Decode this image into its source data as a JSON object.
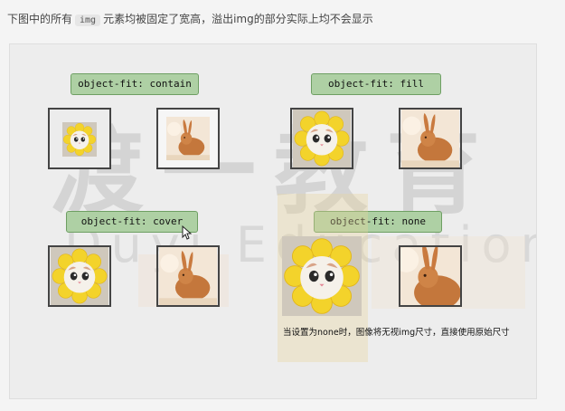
{
  "intro": {
    "prefix": "下图中的所有",
    "code": "img",
    "suffix": "元素均被固定了宽高，溢出img的部分实际上均不会显示"
  },
  "watermark": {
    "chinese": "渡一教育",
    "english": "Duyi Education"
  },
  "demos": [
    {
      "label": "object-fit: contain"
    },
    {
      "label": "object-fit: fill"
    },
    {
      "label": "object-fit: cover"
    },
    {
      "label": "object-fit:  none"
    }
  ],
  "note": "当设置为none时，图像将无视img尺寸，直接使用原始尺寸",
  "colors": {
    "tag_bg": "#aed0a4",
    "tag_border": "#6e9f63",
    "flower": "#f0d32c",
    "rabbit": "#c4773c"
  },
  "icons": [
    "cat-flower-image",
    "rabbit-image",
    "mouse-pointer-icon"
  ]
}
